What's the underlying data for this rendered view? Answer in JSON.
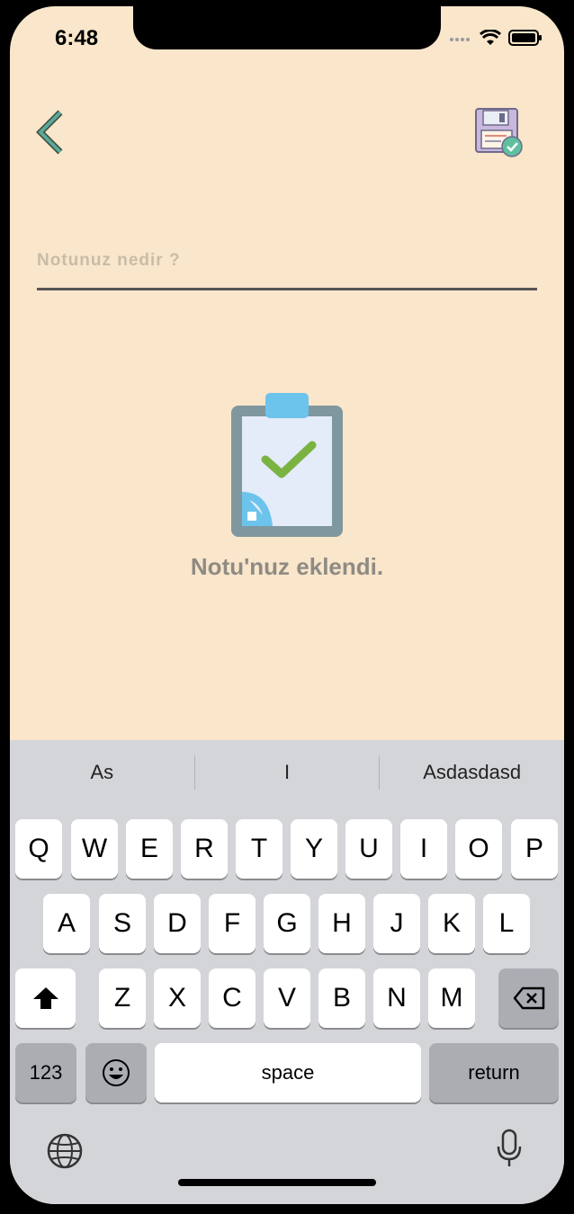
{
  "status_bar": {
    "time": "6:48"
  },
  "header": {
    "back_icon": "chevron-left-icon",
    "save_icon": "floppy-disk-check-icon"
  },
  "note_input": {
    "placeholder": "Notunuz nedir ?",
    "value": ""
  },
  "empty_state": {
    "illustration": "clipboard-check-icon",
    "message": "Notu'nuz eklendi."
  },
  "keyboard": {
    "suggestions": [
      "As",
      "I",
      "Asdasdasd"
    ],
    "row1": [
      "Q",
      "W",
      "E",
      "R",
      "T",
      "Y",
      "U",
      "I",
      "O",
      "P"
    ],
    "row2": [
      "A",
      "S",
      "D",
      "F",
      "G",
      "H",
      "J",
      "K",
      "L"
    ],
    "row3": [
      "Z",
      "X",
      "C",
      "V",
      "B",
      "N",
      "M"
    ],
    "numbers_label": "123",
    "space_label": "space",
    "return_label": "return"
  },
  "colors": {
    "background": "#f9e6cb",
    "accent_teal": "#5aa89a",
    "message_gray": "#8f8b83",
    "keyboard_bg": "#d4d5d9"
  }
}
